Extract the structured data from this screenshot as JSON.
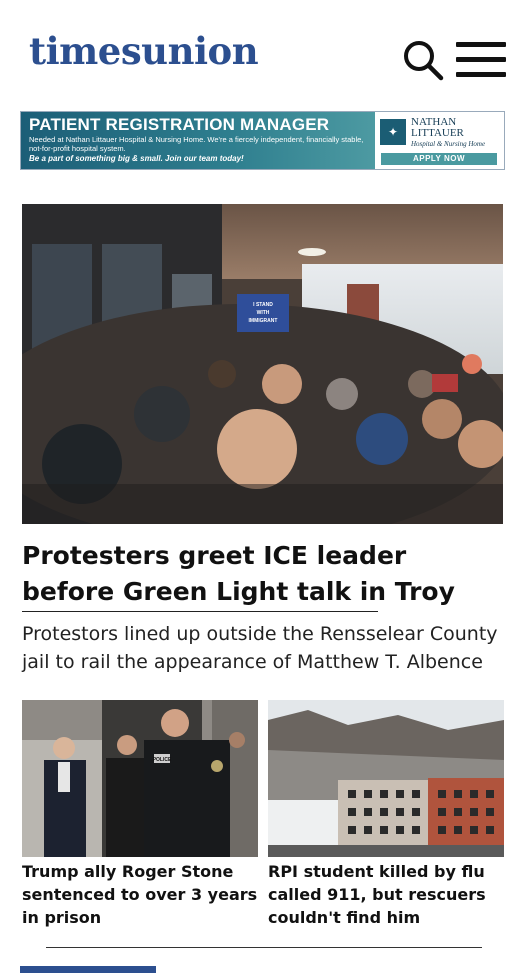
{
  "header": {
    "logo": "timesunion",
    "search_icon": "search-icon",
    "menu_icon": "hamburger-menu-icon"
  },
  "ad": {
    "title": "PATIENT REGISTRATION MANAGER",
    "body": "Needed at Nathan Littauer Hospital & Nursing Home. We're a fiercely independent, financially stable, not-for-profit hospital system.",
    "tagline": "Be a part of something big & small. Join our team today!",
    "brand_line1": "NATHAN",
    "brand_line2": "LITTAUER",
    "brand_sub": "Hospital & Nursing Home",
    "cta": "APPLY NOW",
    "colors": {
      "teal": "#2f7f8f",
      "apply": "#4a9aa0"
    }
  },
  "hero": {
    "headline": "Protesters greet ICE leader before Green Light talk in Troy",
    "summary": "Protestors lined up outside the Rensselear County jail to rail the appearance of Matthew T. Albence",
    "sign_text": "I STAND WITH IMMIGRANT NEW YORKERS"
  },
  "stories": [
    {
      "headline": "Trump ally Roger Stone sentenced to over 3 years in prison",
      "badge": "POLICE"
    },
    {
      "headline": "RPI student killed by flu called 911, but rescuers couldn't find him"
    }
  ],
  "brand_color": "#2c4f8f"
}
